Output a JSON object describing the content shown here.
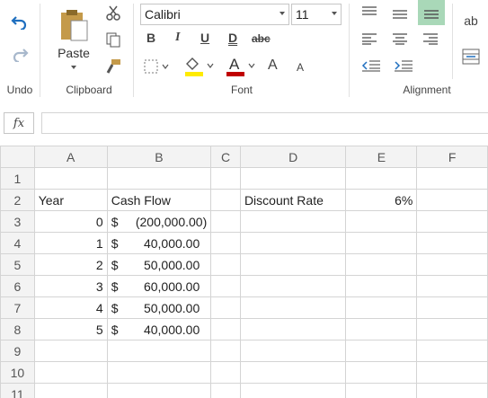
{
  "ribbon": {
    "undo_label": "Undo",
    "clipboard": {
      "paste_label": "Paste",
      "group_label": "Clipboard"
    },
    "font": {
      "name": "Calibri",
      "size": "11",
      "bold": "B",
      "italic": "I",
      "underline": "U",
      "double_underline": "D",
      "strike": "abc",
      "grow": "A",
      "shrink": "A",
      "font_color": "A",
      "group_label": "Font",
      "accent_fill": "#ffeb00",
      "accent_font": "#c00000"
    },
    "alignment": {
      "group_label": "Alignment",
      "wrap_glyph": "ab"
    }
  },
  "formula_bar": {
    "fx": "fx",
    "value": ""
  },
  "sheet": {
    "columns": [
      "A",
      "B",
      "C",
      "D",
      "E",
      "F"
    ],
    "rows": [
      "1",
      "2",
      "3",
      "4",
      "5",
      "6",
      "7",
      "8",
      "9",
      "10",
      "11"
    ],
    "cells": {
      "A2": "Year",
      "B2": "Cash Flow",
      "D2": "Discount Rate",
      "E2": "6%",
      "A3": "0",
      "B3_sym": "$",
      "B3_val": "(200,000.00)",
      "A4": "1",
      "B4_sym": "$",
      "B4_val": "40,000.00",
      "A5": "2",
      "B5_sym": "$",
      "B5_val": "50,000.00",
      "A6": "3",
      "B6_sym": "$",
      "B6_val": "60,000.00",
      "A7": "4",
      "B7_sym": "$",
      "B7_val": "50,000.00",
      "A8": "5",
      "B8_sym": "$",
      "B8_val": "40,000.00"
    }
  }
}
